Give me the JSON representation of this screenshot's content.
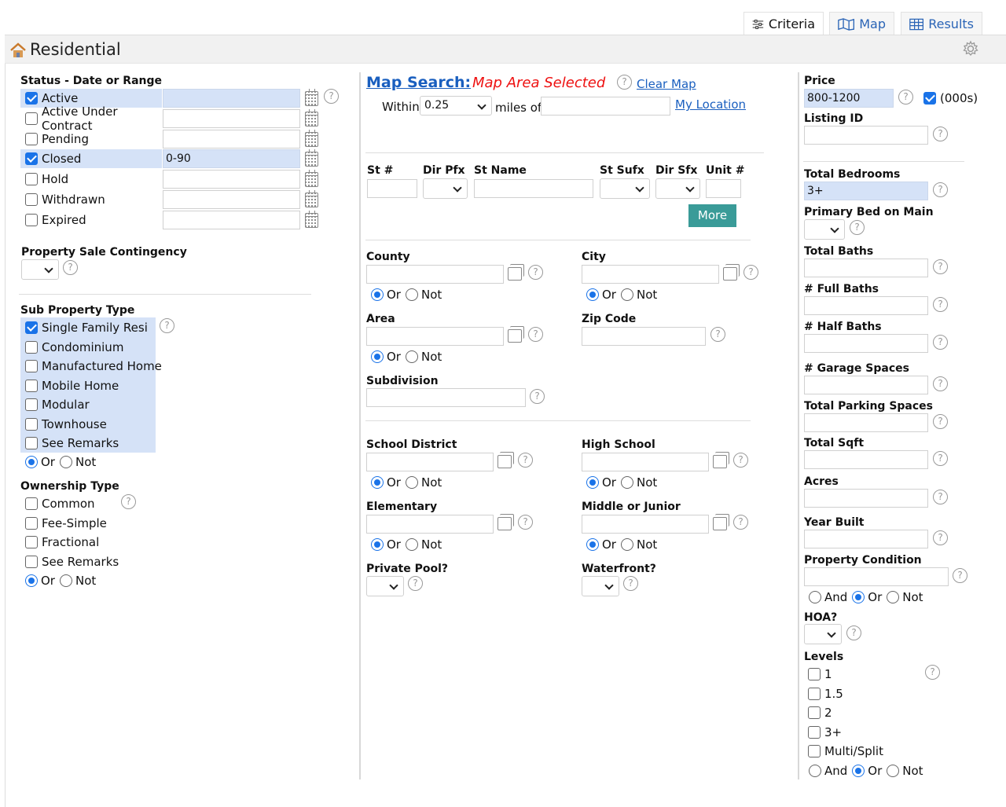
{
  "tabs": {
    "criteria": "Criteria",
    "map": "Map",
    "results": "Results"
  },
  "header": {
    "title": "Residential"
  },
  "status": {
    "heading": "Status - Date or Range",
    "items": [
      {
        "label": "Active",
        "checked": true,
        "value": ""
      },
      {
        "label": "Active Under Contract",
        "checked": false,
        "value": ""
      },
      {
        "label": "Pending",
        "checked": false,
        "value": ""
      },
      {
        "label": "Closed",
        "checked": true,
        "value": "0-90"
      },
      {
        "label": "Hold",
        "checked": false,
        "value": ""
      },
      {
        "label": "Withdrawn",
        "checked": false,
        "value": ""
      },
      {
        "label": "Expired",
        "checked": false,
        "value": ""
      }
    ]
  },
  "contingency": {
    "heading": "Property Sale Contingency"
  },
  "sub_type": {
    "heading": "Sub Property Type",
    "items": [
      "Single Family Resi",
      "Condominium",
      "Manufactured Home",
      "Mobile Home",
      "Modular",
      "Townhouse",
      "See Remarks"
    ],
    "or": "Or",
    "not": "Not"
  },
  "ownership": {
    "heading": "Ownership Type",
    "items": [
      "Common",
      "Fee-Simple",
      "Fractional",
      "See Remarks"
    ],
    "or": "Or",
    "not": "Not"
  },
  "map_search": {
    "title": "Map Search:",
    "selected": "Map Area Selected",
    "clear": "Clear Map",
    "within": "Within",
    "miles": "0.25",
    "miles_of": "miles of",
    "my_location": "My Location"
  },
  "address": {
    "st_num": "St #",
    "dir_pfx": "Dir Pfx",
    "st_name": "St Name",
    "st_sufx": "St Sufx",
    "dir_sfx": "Dir Sfx",
    "unit": "Unit #",
    "more": "More"
  },
  "geo": {
    "county": "County",
    "city": "City",
    "area": "Area",
    "zip": "Zip Code",
    "subdivision": "Subdivision",
    "or": "Or",
    "not": "Not"
  },
  "schools": {
    "district": "School District",
    "high": "High School",
    "elementary": "Elementary",
    "middle": "Middle or Junior",
    "pool": "Private Pool?",
    "waterfront": "Waterfront?"
  },
  "right": {
    "price": "Price",
    "price_value": "800-1200",
    "thousands": "(000s)",
    "listing_id": "Listing ID",
    "bedrooms": "Total Bedrooms",
    "bedrooms_value": "3+",
    "primary_bed": "Primary Bed on Main",
    "total_baths": "Total Baths",
    "full_baths": "# Full Baths",
    "half_baths": "# Half Baths",
    "garage": "# Garage Spaces",
    "parking": "Total Parking Spaces",
    "sqft": "Total Sqft",
    "acres": "Acres",
    "year": "Year Built",
    "condition": "Property Condition",
    "and": "And",
    "or": "Or",
    "not": "Not",
    "hoa": "HOA?",
    "levels": "Levels",
    "level_items": [
      "1",
      "1.5",
      "2",
      "3+",
      "Multi/Split"
    ]
  },
  "q": "?"
}
